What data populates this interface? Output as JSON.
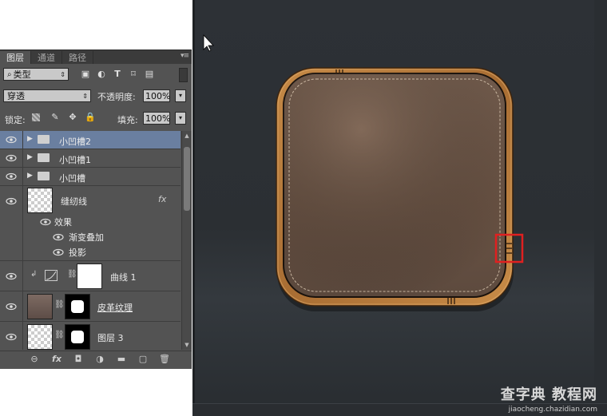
{
  "tabs": [
    "图层",
    "通道",
    "路径"
  ],
  "panel_menu_icon": "menu-icon",
  "filter": {
    "kind_label": "类型",
    "icons": [
      "image-filter-icon",
      "adjustment-filter-icon",
      "type-filter-icon",
      "shape-filter-icon",
      "smart-object-filter-icon"
    ]
  },
  "blend": {
    "mode": "穿透",
    "opacity_label": "不透明度:",
    "opacity": "100%"
  },
  "lock": {
    "label": "锁定:",
    "fill_label": "填充:",
    "fill": "100%"
  },
  "layers": [
    {
      "name": "小凹槽2",
      "type": "group",
      "selected": true
    },
    {
      "name": "小凹槽1",
      "type": "group",
      "selected": false
    },
    {
      "name": "小凹槽",
      "type": "group",
      "selected": false
    },
    {
      "name": "缝纫线",
      "type": "layer",
      "fx": "fx"
    },
    {
      "name": "效果",
      "type": "effects"
    },
    {
      "name": "渐变叠加",
      "type": "effect"
    },
    {
      "name": "投影",
      "type": "effect"
    },
    {
      "name": "曲线 1",
      "type": "adjustment"
    },
    {
      "name": "皮革纹理",
      "type": "layer-mask"
    },
    {
      "name": "图层 3",
      "type": "layer-mask"
    }
  ],
  "bottom_icons": [
    "link-icon",
    "fx-icon",
    "mask-icon",
    "adjustment-icon",
    "folder-icon",
    "new-layer-icon",
    "trash-icon"
  ],
  "bottom_fx": "fx",
  "canvas": {
    "icon_colors": {
      "wood": "#b27a3c",
      "leather": "#6e5646",
      "highlight": "#e02020"
    }
  },
  "watermark": {
    "main": "查字典 教程网",
    "sub": "jiaocheng.chazidian.com"
  }
}
